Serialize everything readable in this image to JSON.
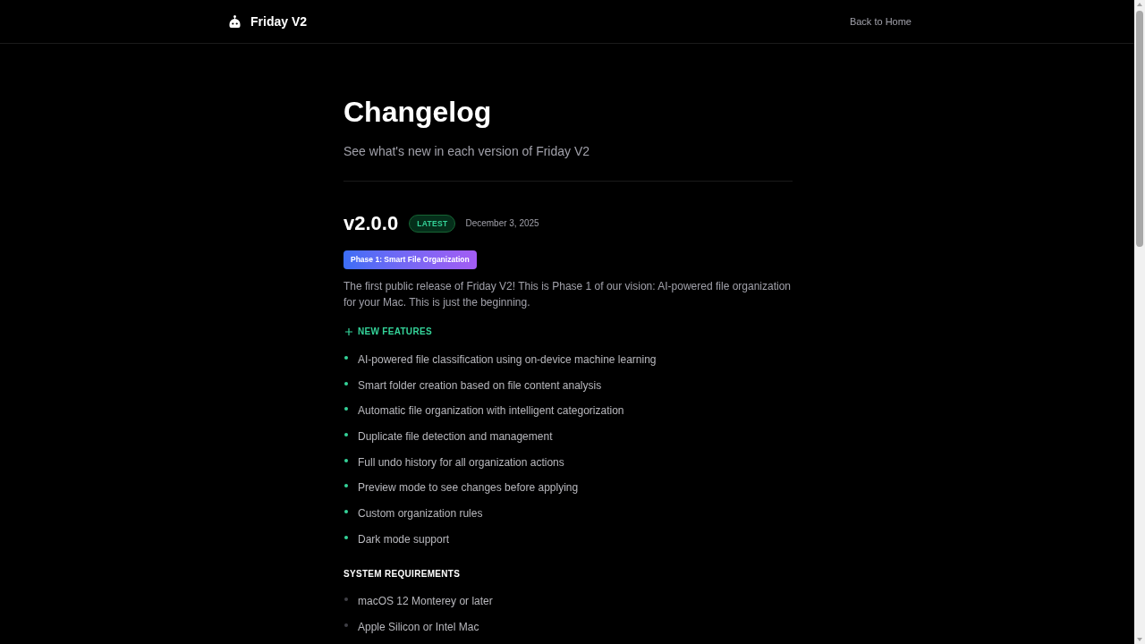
{
  "header": {
    "brand": "Friday V2",
    "nav_link": "Back to Home"
  },
  "page": {
    "title": "Changelog",
    "subtitle": "See what's new in each version of Friday V2"
  },
  "releases": [
    {
      "version": "v2.0.0",
      "badge": "LATEST",
      "date": "December 3, 2025",
      "phase": "Phase 1: Smart File Organization",
      "summary": "The first public release of Friday V2! This is Phase 1 of our vision: AI-powered file organization for your Mac. This is just the beginning.",
      "sections": [
        {
          "kind": "features",
          "title": "NEW FEATURES",
          "items": [
            "AI-powered file classification using on-device machine learning",
            "Smart folder creation based on file content analysis",
            "Automatic file organization with intelligent categorization",
            "Duplicate file detection and management",
            "Full undo history for all organization actions",
            "Preview mode to see changes before applying",
            "Custom organization rules",
            "Dark mode support"
          ]
        },
        {
          "kind": "requirements",
          "title": "SYSTEM REQUIREMENTS",
          "items": [
            "macOS 12 Monterey or later",
            "Apple Silicon or Intel Mac"
          ]
        }
      ]
    }
  ]
}
